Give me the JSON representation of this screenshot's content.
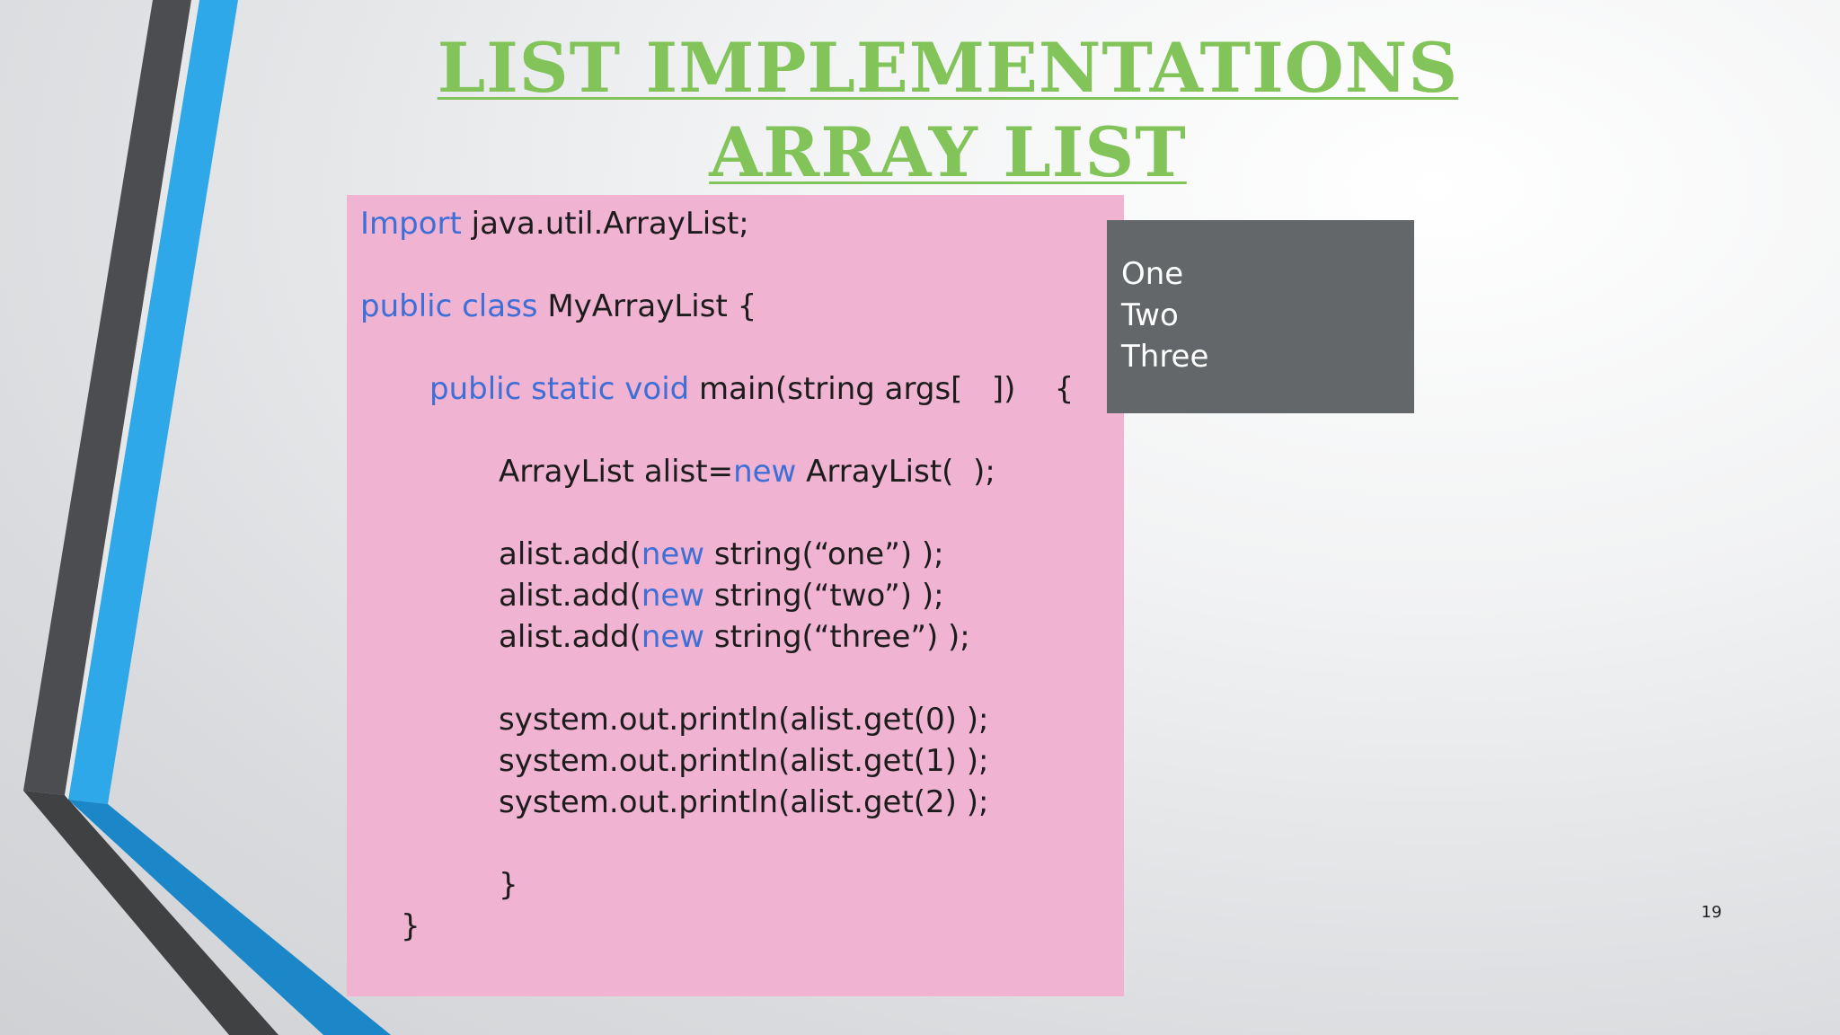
{
  "slide": {
    "title_line1": "LIST IMPLEMENTATIONS",
    "title_line2": "ARRAY LIST",
    "page_number": "19",
    "colors": {
      "title": "#82c45a",
      "code_background": "#f0b3d2",
      "keyword": "#3d6fd6",
      "code_text": "#1c1c1c",
      "output_background": "#636769",
      "output_text": "#ffffff",
      "accent_blue": "#2ea8e8",
      "accent_dark": "#4a4c4f"
    }
  },
  "code": {
    "l1_kw": "Import",
    "l1_text": " java.util.ArrayList;",
    "l2_kw": "public class",
    "l2_text": " MyArrayList {",
    "l3_kw": "public static void",
    "l3_text": " main(string args[   ])    {",
    "l4_text_a": "ArrayList alist=",
    "l4_kw": "new",
    "l4_text_b": " ArrayList(  );",
    "l5_text_a": "alist.add(",
    "l5_kw": "new",
    "l5_text_b": " string(“one”) );",
    "l6_text_a": "alist.add(",
    "l6_kw": "new",
    "l6_text_b": " string(“two”) );",
    "l7_text_a": "alist.add(",
    "l7_kw": "new",
    "l7_text_b": " string(“three”) );",
    "l8_text": "system.out.println(alist.get(0) );",
    "l9_text": "system.out.println(alist.get(1) );",
    "l10_text": "system.out.println(alist.get(2) );",
    "l11_text": "}",
    "l12_text": "}"
  },
  "output": {
    "lines": [
      "One",
      "Two",
      "Three"
    ]
  }
}
